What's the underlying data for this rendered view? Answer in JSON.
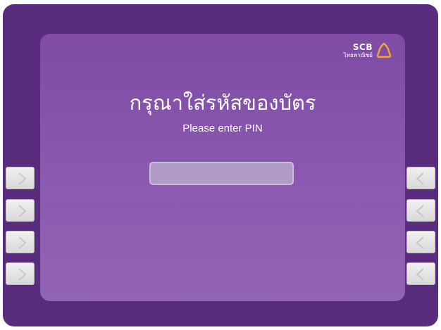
{
  "brand": {
    "name": "SCB",
    "name_thai": "ไทยพาณิชย์",
    "logo_icon": "bell-logo-icon",
    "logo_color": "#f6a623"
  },
  "prompt": {
    "title_thai": "กรุณาใส่รหัสของบัตร",
    "title_english": "Please enter PIN"
  },
  "pin_field": {
    "value": ""
  },
  "side_buttons": {
    "left_icon": "arrow-right-icon",
    "right_icon": "arrow-left-icon",
    "count_per_side": 4
  },
  "colors": {
    "frame": "#5a2c7e",
    "screen": "#8b59af",
    "text": "#ffffff"
  }
}
